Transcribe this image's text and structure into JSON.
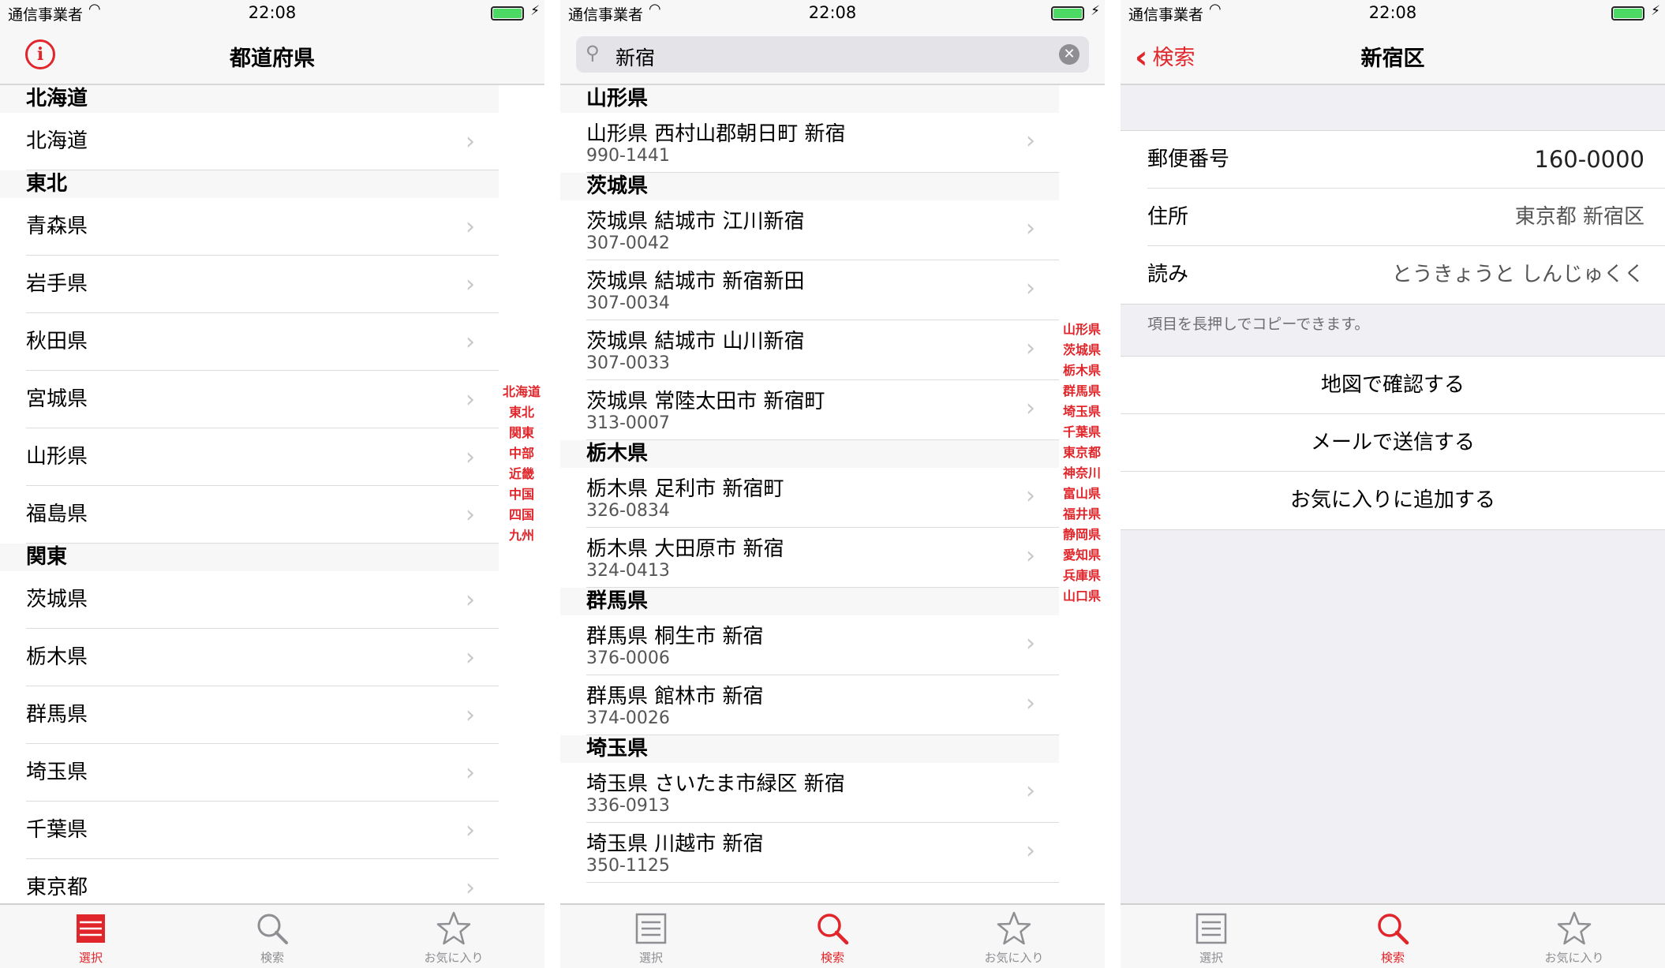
{
  "colors": {
    "accent": "#e0262b",
    "gray": "#8e8e93",
    "battery": "#4cd964"
  },
  "status_bar": {
    "carrier": "通信事業者",
    "time": "22:08"
  },
  "screen1": {
    "nav_title": "都道府県",
    "sections": [
      {
        "header": "北海道",
        "items": [
          "北海道"
        ]
      },
      {
        "header": "東北",
        "items": [
          "青森県",
          "岩手県",
          "秋田県",
          "宮城県",
          "山形県",
          "福島県"
        ]
      },
      {
        "header": "関東",
        "items": [
          "茨城県",
          "栃木県",
          "群馬県",
          "埼玉県",
          "千葉県",
          "東京都"
        ]
      }
    ],
    "index": [
      "北海道",
      "東北",
      "関東",
      "中部",
      "近畿",
      "中国",
      "四国",
      "九州"
    ]
  },
  "screen2": {
    "search_value": "新宿",
    "sections": [
      {
        "header": "山形県",
        "items": [
          {
            "address": "山形県 西村山郡朝日町 新宿",
            "zip": "990-1441"
          }
        ]
      },
      {
        "header": "茨城県",
        "items": [
          {
            "address": "茨城県 結城市 江川新宿",
            "zip": "307-0042"
          },
          {
            "address": "茨城県 結城市 新宿新田",
            "zip": "307-0034"
          },
          {
            "address": "茨城県 結城市 山川新宿",
            "zip": "307-0033"
          },
          {
            "address": "茨城県 常陸太田市 新宿町",
            "zip": "313-0007"
          }
        ]
      },
      {
        "header": "栃木県",
        "items": [
          {
            "address": "栃木県 足利市 新宿町",
            "zip": "326-0834"
          },
          {
            "address": "栃木県 大田原市 新宿",
            "zip": "324-0413"
          }
        ]
      },
      {
        "header": "群馬県",
        "items": [
          {
            "address": "群馬県 桐生市 新宿",
            "zip": "376-0006"
          },
          {
            "address": "群馬県 館林市 新宿",
            "zip": "374-0026"
          }
        ]
      },
      {
        "header": "埼玉県",
        "items": [
          {
            "address": "埼玉県 さいたま市緑区 新宿",
            "zip": "336-0913"
          },
          {
            "address": "埼玉県 川越市 新宿",
            "zip": "350-1125"
          }
        ]
      }
    ],
    "index": [
      "山形県",
      "茨城県",
      "栃木県",
      "群馬県",
      "埼玉県",
      "千葉県",
      "東京都",
      "神奈川",
      "富山県",
      "福井県",
      "静岡県",
      "愛知県",
      "兵庫県",
      "山口県"
    ]
  },
  "screen3": {
    "back_label": "検索",
    "nav_title": "新宿区",
    "fields": [
      {
        "label": "郵便番号",
        "value": "160-0000"
      },
      {
        "label": "住所",
        "value": "東京都 新宿区"
      },
      {
        "label": "読み",
        "value": "とうきょうと しんじゅくく"
      }
    ],
    "footnote": "項目を長押しでコピーできます。",
    "actions": [
      "地図で確認する",
      "メールで送信する",
      "お気に入りに追加する"
    ]
  },
  "tabs": [
    {
      "label": "選択",
      "icon": "list-icon"
    },
    {
      "label": "検索",
      "icon": "search-icon"
    },
    {
      "label": "お気に入り",
      "icon": "star-icon"
    }
  ],
  "active_tab": {
    "screen1": 0,
    "screen2": 1,
    "screen3": 1
  }
}
